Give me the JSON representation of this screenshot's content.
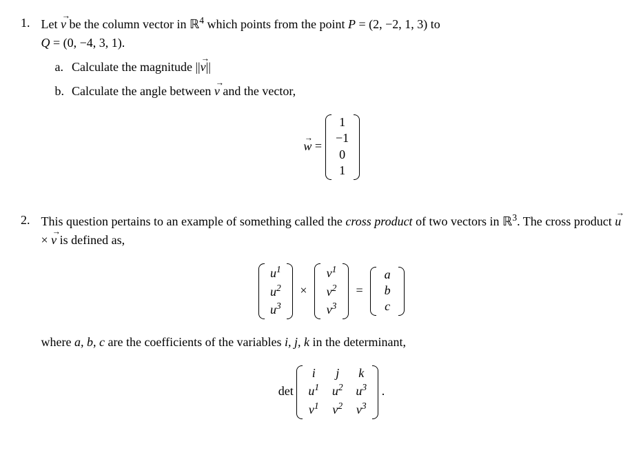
{
  "q1": {
    "num": "1.",
    "text_pre": "Let ",
    "vec_v": "v",
    "text_mid1": " be the column vector in ",
    "R4": "ℝ",
    "R4_sup": "4",
    "text_mid2": " which points from the point ",
    "P": "P",
    "eq1": " = (2, −2, 1, 3) to",
    "Q": "Q",
    "eq2": " = (0, −4, 3, 1).",
    "a": {
      "label": "a.",
      "text1": "Calculate the magnitude ",
      "norm_open": "||",
      "vec_v": "v",
      "norm_close": "||"
    },
    "b": {
      "label": "b.",
      "text1": "Calculate the angle between ",
      "vec_v": "v",
      "text2": " and the vector,",
      "w_eq": {
        "lhs_vec": "w",
        "eq": " = ",
        "col": [
          "1",
          "−1",
          "0",
          "1"
        ]
      }
    }
  },
  "q2": {
    "num": "2.",
    "text1": "This question pertains to an example of something called the ",
    "italic1": "cross product",
    "text2": " of two vectors in ",
    "R3": "ℝ",
    "R3_sup": "3",
    "text3": ". The cross product ",
    "vec_u": "u",
    "times": " × ",
    "vec_v": "v",
    "text4": " is defined as,",
    "cross_eq": {
      "u_col": [
        "u",
        "u",
        "u"
      ],
      "u_sup": [
        "1",
        "2",
        "3"
      ],
      "times": "×",
      "v_col": [
        "v",
        "v",
        "v"
      ],
      "v_sup": [
        "1",
        "2",
        "3"
      ],
      "eq": "=",
      "r_col": [
        "a",
        "b",
        "c"
      ]
    },
    "text5": "where ",
    "abc": "a, b, c",
    "text6": " are the coefficients of the variables ",
    "ijk": "i, j, k",
    "text7": " in the determinant,",
    "det_eq": {
      "det": "det",
      "row1": [
        "i",
        "j",
        "k"
      ],
      "row2_base": [
        "u",
        "u",
        "u"
      ],
      "row2_sup": [
        "1",
        "2",
        "3"
      ],
      "row3_base": [
        "v",
        "v",
        "v"
      ],
      "row3_sup": [
        "1",
        "2",
        "3"
      ],
      "period": "."
    }
  }
}
